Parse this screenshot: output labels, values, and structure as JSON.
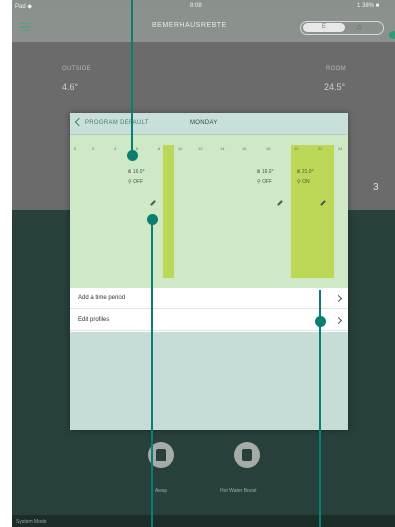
{
  "status_bar": {
    "left": "Pad ◆",
    "center": "8:08",
    "right": "1 38% ■"
  },
  "nav": {
    "title": "BEMERHAUSREBTE",
    "toggle_left": "E",
    "toggle_right": "⌂"
  },
  "outdoor": {
    "label": "OUTSIDE",
    "value": "4.6°"
  },
  "indoor": {
    "label": "ROOM",
    "value": "24.5°"
  },
  "side_value": "3",
  "bottom": {
    "left_button_label": "Away",
    "right_button_label": "Hot Water Boost",
    "footer": "System Mode"
  },
  "modal": {
    "back_label": "PROGRAM DEFAULT",
    "day_label": "MONDAY",
    "ticks": [
      "0",
      "2",
      "4",
      "6",
      "8",
      "10",
      "12",
      "14",
      "16",
      "18",
      "20",
      "22",
      "24"
    ],
    "periods": [
      {
        "temp": "16.0°",
        "mode": "OFF"
      },
      {
        "temp": "16.0°",
        "mode": "OFF"
      },
      {
        "temp": "21.0°",
        "mode": "ON"
      }
    ],
    "rows": [
      {
        "label": "Add a time period"
      },
      {
        "label": "Edit profiles"
      }
    ]
  },
  "colors": {
    "callout": "#0b7e73",
    "band": "#bcd856",
    "accent": "#3f7f6e"
  }
}
